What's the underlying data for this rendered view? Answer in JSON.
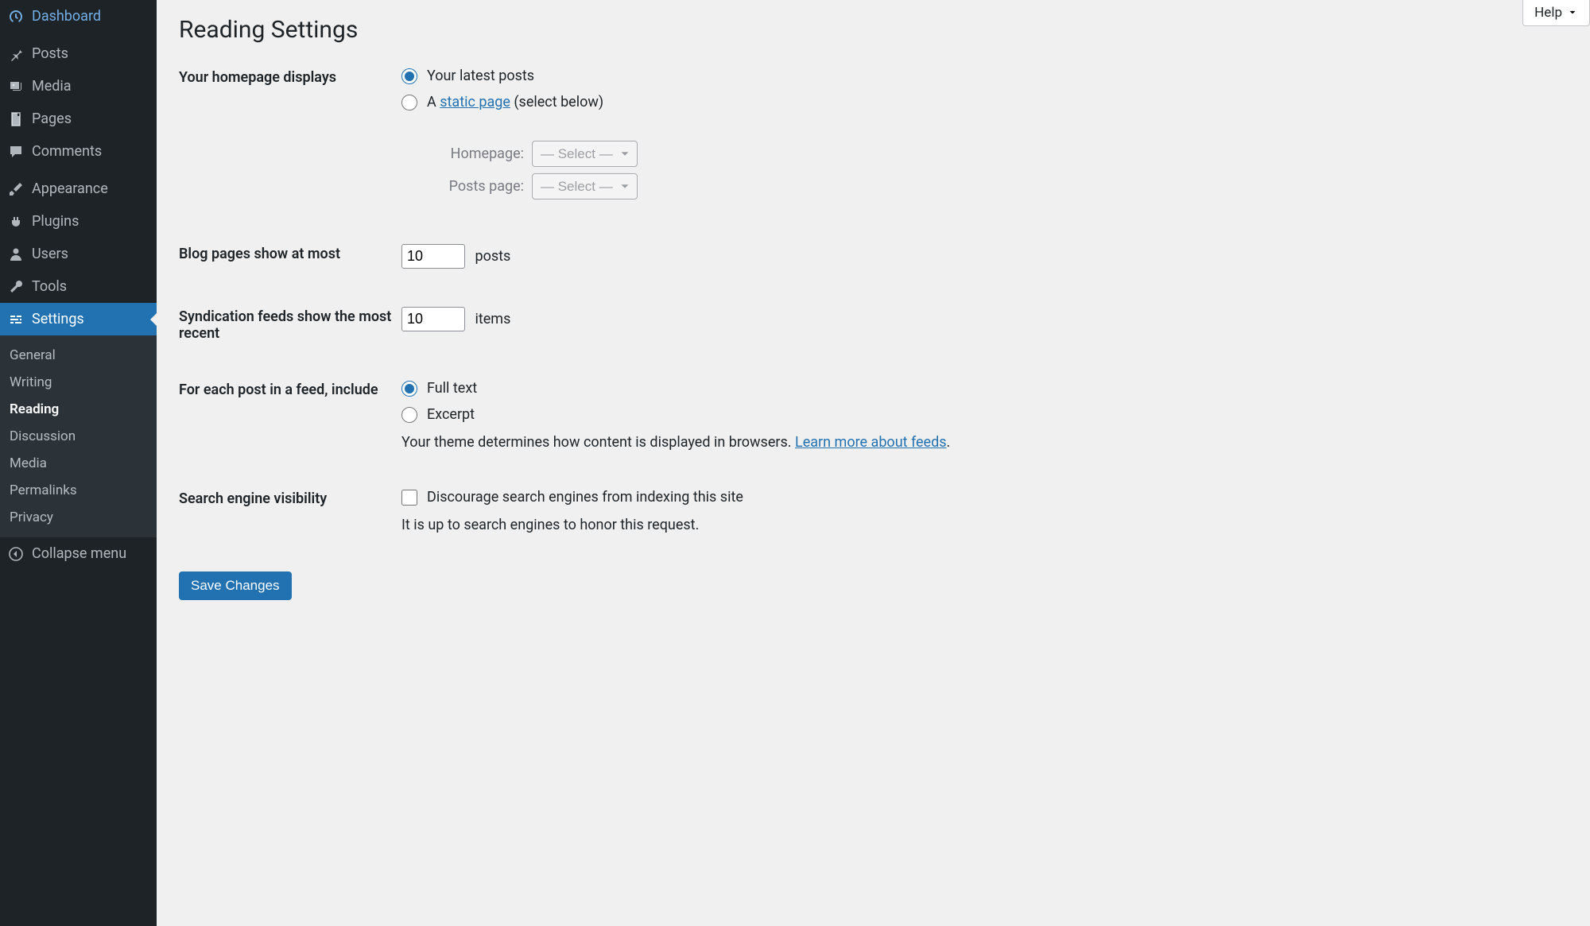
{
  "sidebar": {
    "items": [
      {
        "label": "Dashboard",
        "icon": "dashboard"
      },
      {
        "label": "Posts",
        "icon": "pin"
      },
      {
        "label": "Media",
        "icon": "media"
      },
      {
        "label": "Pages",
        "icon": "page"
      },
      {
        "label": "Comments",
        "icon": "comment"
      },
      {
        "label": "Appearance",
        "icon": "brush"
      },
      {
        "label": "Plugins",
        "icon": "plug"
      },
      {
        "label": "Users",
        "icon": "user"
      },
      {
        "label": "Tools",
        "icon": "wrench"
      },
      {
        "label": "Settings",
        "icon": "sliders",
        "current": true
      }
    ],
    "submenu": [
      {
        "label": "General"
      },
      {
        "label": "Writing"
      },
      {
        "label": "Reading",
        "current": true
      },
      {
        "label": "Discussion"
      },
      {
        "label": "Media"
      },
      {
        "label": "Permalinks"
      },
      {
        "label": "Privacy"
      }
    ],
    "collapse_label": "Collapse menu"
  },
  "help_label": "Help",
  "page_title": "Reading Settings",
  "rows": {
    "homepage": {
      "label": "Your homepage displays",
      "opt_latest": "Your latest posts",
      "opt_static_prefix": "A ",
      "opt_static_link": "static page",
      "opt_static_suffix": " (select below)",
      "homepage_label": "Homepage:",
      "posts_page_label": "Posts page:",
      "select_placeholder": "— Select —"
    },
    "blog_pages": {
      "label": "Blog pages show at most",
      "value": "10",
      "suffix": "posts"
    },
    "syndication": {
      "label": "Syndication feeds show the most recent",
      "value": "10",
      "suffix": "items"
    },
    "feed_include": {
      "label": "For each post in a feed, include",
      "opt_full": "Full text",
      "opt_excerpt": "Excerpt",
      "desc_prefix": "Your theme determines how content is displayed in browsers. ",
      "desc_link": "Learn more about feeds",
      "desc_suffix": "."
    },
    "search_vis": {
      "label": "Search engine visibility",
      "checkbox": "Discourage search engines from indexing this site",
      "desc": "It is up to search engines to honor this request."
    }
  },
  "save_label": "Save Changes"
}
